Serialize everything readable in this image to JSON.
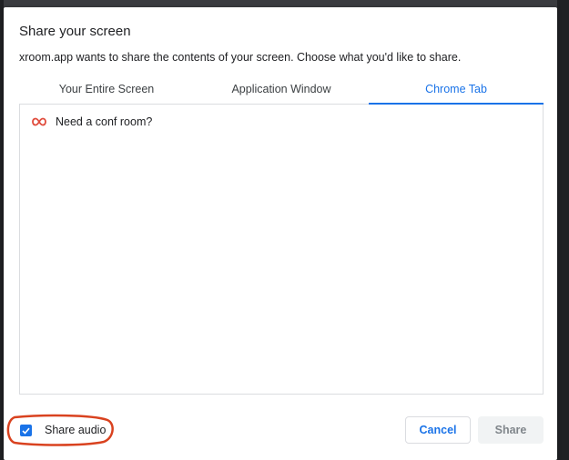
{
  "dialog": {
    "title": "Share your screen",
    "subtitle": "xroom.app wants to share the contents of your screen. Choose what you'd like to share."
  },
  "tabs": [
    {
      "label": "Your Entire Screen",
      "active": false
    },
    {
      "label": "Application Window",
      "active": false
    },
    {
      "label": "Chrome Tab",
      "active": true
    }
  ],
  "tab_list": {
    "items": [
      {
        "label": "Need a conf room?",
        "icon": "infinity-icon"
      }
    ]
  },
  "footer": {
    "share_audio_label": "Share audio",
    "share_audio_checked": true,
    "cancel_label": "Cancel",
    "share_label": "Share"
  },
  "colors": {
    "accent": "#1a73e8",
    "favicon": "#e04b3c",
    "annotation": "#d9421f"
  }
}
